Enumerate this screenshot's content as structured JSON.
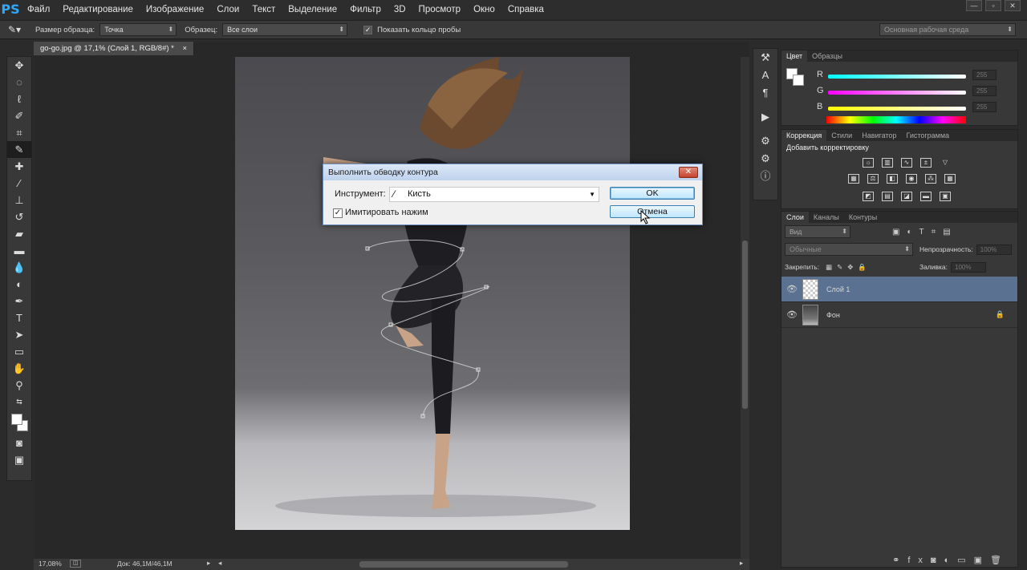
{
  "app": {
    "logo": "PS"
  },
  "menu": [
    "Файл",
    "Редактирование",
    "Изображение",
    "Слои",
    "Текст",
    "Выделение",
    "Фильтр",
    "3D",
    "Просмотр",
    "Окно",
    "Справка"
  ],
  "options": {
    "sample_size_label": "Размер образца:",
    "sample_size_value": "Точка",
    "sample_label": "Образец:",
    "sample_value": "Все слои",
    "show_ring_label": "Показать кольцо пробы",
    "workspace": "Основная рабочая среда"
  },
  "document": {
    "tab_title": "go-go.jpg @ 17,1% (Слой 1, RGB/8#) *",
    "tab_close": "×"
  },
  "status": {
    "zoom": "17,08%",
    "doc_info": "Док: 46,1M/46,1M"
  },
  "color_panel": {
    "tabs": [
      "Цвет",
      "Образцы"
    ],
    "channels": [
      {
        "label": "R",
        "value": "255"
      },
      {
        "label": "G",
        "value": "255"
      },
      {
        "label": "B",
        "value": "255"
      }
    ]
  },
  "adjustments_panel": {
    "tabs": [
      "Коррекция",
      "Стили",
      "Навигатор",
      "Гистограмма"
    ],
    "heading": "Добавить корректировку"
  },
  "layers_panel": {
    "tabs": [
      "Слои",
      "Каналы",
      "Контуры"
    ],
    "kind_filter": "Вид",
    "blend_mode": "Обычные",
    "opacity_label": "Непрозрачность:",
    "opacity_value": "100%",
    "lock_label": "Закрепить:",
    "fill_label": "Заливка:",
    "fill_value": "100%",
    "layers": [
      {
        "name": "Слой 1",
        "selected": true
      },
      {
        "name": "Фон",
        "locked": true
      }
    ]
  },
  "dialog": {
    "title": "Выполнить обводку контура",
    "tool_label": "Инструмент:",
    "tool_value": "Кисть",
    "simulate_label": "Имитировать нажим",
    "simulate_checked": true,
    "ok_label": "OK",
    "cancel_label": "Отмена"
  },
  "colors": {
    "accent_blue": "#31a8ff",
    "selected_layer": "#5a7191"
  }
}
